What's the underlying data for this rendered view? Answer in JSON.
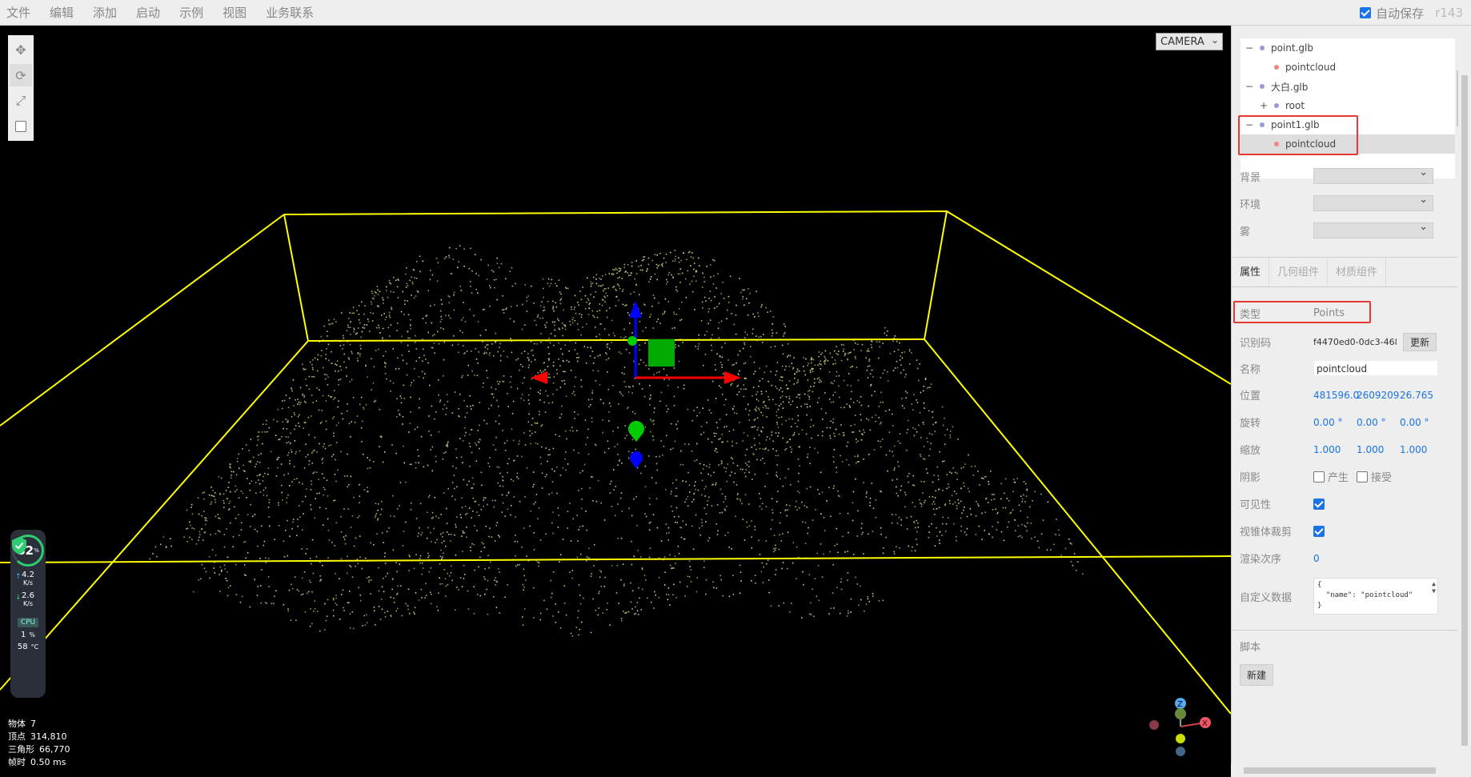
{
  "menu": [
    "文件",
    "编辑",
    "添加",
    "启动",
    "示例",
    "视图",
    "业务联系"
  ],
  "menubar_right": {
    "autosave_label": "自动保存",
    "version": "r143"
  },
  "camera_select": {
    "value": "CAMERA"
  },
  "outliner": {
    "items": [
      {
        "label": "point.glb",
        "toggle": "−",
        "level": 0,
        "dot_color": "#9999dd"
      },
      {
        "label": "pointcloud",
        "toggle": "",
        "level": 1,
        "dot_color": "#ee8888"
      },
      {
        "label": "大白.glb",
        "toggle": "−",
        "level": 0,
        "dot_color": "#9999dd"
      },
      {
        "label": "root",
        "toggle": "+",
        "level": 1,
        "dot_color": "#9999dd"
      },
      {
        "label": "point1.glb",
        "toggle": "−",
        "level": 0,
        "dot_color": "#9999dd"
      },
      {
        "label": "pointcloud",
        "toggle": "",
        "level": 1,
        "dot_color": "#ee8888",
        "selected": true
      }
    ]
  },
  "scene": {
    "background_label": "背景",
    "environment_label": "环境",
    "fog_label": "雾"
  },
  "tabs": [
    "属性",
    "几何组件",
    "材质组件"
  ],
  "properties": {
    "type_label": "类型",
    "type_value": "Points",
    "uuid_label": "识别码",
    "uuid_value": "f4470ed0-0dc3-468",
    "uuid_button": "更新",
    "name_label": "名称",
    "name_value": "pointcloud",
    "position_label": "位置",
    "position": [
      "481596.0",
      "2609209.",
      "26.765"
    ],
    "rotation_label": "旋转",
    "rotation": [
      "0.00 °",
      "0.00 °",
      "0.00 °"
    ],
    "scale_label": "缩放",
    "scale": [
      "1.000",
      "1.000",
      "1.000"
    ],
    "shadow_label": "阴影",
    "shadow_cast": "产生",
    "shadow_receive": "接受",
    "visible_label": "可见性",
    "frustum_label": "视锥体裁剪",
    "render_order_label": "渲染次序",
    "render_order": "0",
    "userdata_label": "自定义数据",
    "userdata_value": "{\n  \"name\": \"pointcloud\"\n}"
  },
  "script": {
    "label": "脚本",
    "new_button": "新建"
  },
  "info": {
    "objects_label": "物体",
    "objects": "7",
    "vertices_label": "顶点",
    "vertices": "314,810",
    "triangles_label": "三角形",
    "triangles": "66,770",
    "frametime_label": "帧时",
    "frametime": "0.50 ms"
  },
  "monitor": {
    "percent": "82",
    "percent_unit": "%",
    "up_speed": "4.2",
    "down_speed": "2.6",
    "speed_unit": "K/s",
    "cpu_label": "CPU",
    "cpu_value": "1",
    "cpu_unit": "%",
    "temp_value": "58",
    "temp_unit": "°C"
  },
  "axis_helper": {
    "x": "X",
    "z": "Z"
  },
  "colors": {
    "bbox": "#ffff00",
    "gizmo_x": "#ff0000",
    "gizmo_y": "#00cc00",
    "gizmo_z": "#0000ff",
    "highlight": "#e53935",
    "accent": "#1a73e8"
  }
}
